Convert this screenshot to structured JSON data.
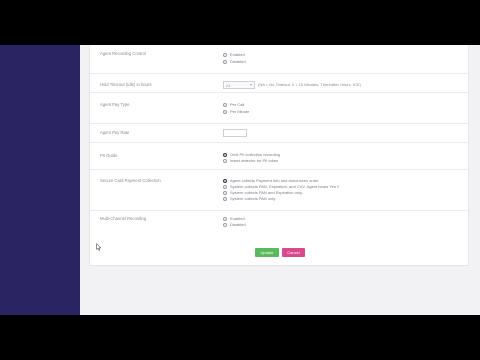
{
  "colors": {
    "sidebar": "#2a2463",
    "update_button": "#5cb85c",
    "cancel_button": "#d84a8c"
  },
  "form": {
    "rows": [
      {
        "label": "Agent Recording Control",
        "options": [
          {
            "label": "Enabled",
            "selected": false
          },
          {
            "label": "Disabled",
            "selected": false
          }
        ]
      },
      {
        "label": "Hold Timeout (Idle) in hours",
        "select_value": "24",
        "hint": "(NA = No Timeout, 0 = 15 Minutes, Thereafter Hours. ICE)"
      },
      {
        "label": "Agent Pay Type",
        "options": [
          {
            "label": "Per Call",
            "selected": false
          },
          {
            "label": "Per Minute",
            "selected": false
          }
        ]
      },
      {
        "label": "Agent Pay Rate",
        "input_value": ""
      },
      {
        "label": "PII Guide",
        "options": [
          {
            "label": "Omit PII collection recording",
            "selected": true
          },
          {
            "label": "Insert detector for PII token",
            "selected": false
          }
        ]
      },
      {
        "label": "Secure Card Payment Collection",
        "options": [
          {
            "label": "Agent collects Payment Info and announces order",
            "selected": true
          },
          {
            "label": "System collects PAN, Expiration, and CVV. Agent hears Yes !!",
            "selected": false
          },
          {
            "label": "System collects PAN and Expiration only.",
            "selected": false
          },
          {
            "label": "System collects PAN only.",
            "selected": false
          }
        ]
      },
      {
        "label": "Multi-Channel Recording",
        "options": [
          {
            "label": "Enabled",
            "selected": false
          },
          {
            "label": "Disabled",
            "selected": false
          }
        ]
      }
    ],
    "update_label": "Update",
    "cancel_label": "Cancel"
  }
}
